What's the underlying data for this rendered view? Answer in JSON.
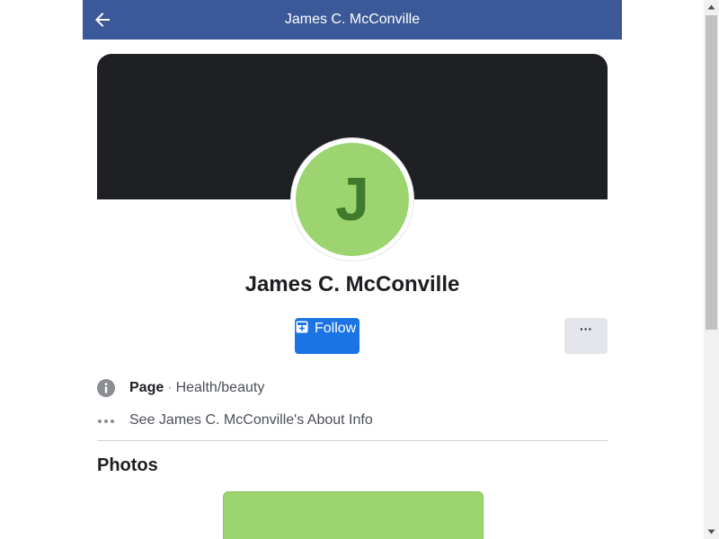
{
  "header": {
    "title": "James C. McConville",
    "back_icon": "arrow-left-icon",
    "background_color": "#3b5998"
  },
  "profile": {
    "avatar_initial": "J",
    "avatar_color": "#9cd46f",
    "avatar_text_color": "#3f7b2c",
    "cover_color": "#1f2023",
    "name": "James C. McConville"
  },
  "actions": {
    "follow_label": "Follow",
    "follow_icon": "follow-plus-icon",
    "follow_color": "#1b74e4",
    "more_label": "···"
  },
  "info": {
    "page_label": "Page",
    "separator": "·",
    "category": "Health/beauty",
    "about_link": "See James C. McConville's About Info"
  },
  "photos": {
    "heading": "Photos"
  }
}
